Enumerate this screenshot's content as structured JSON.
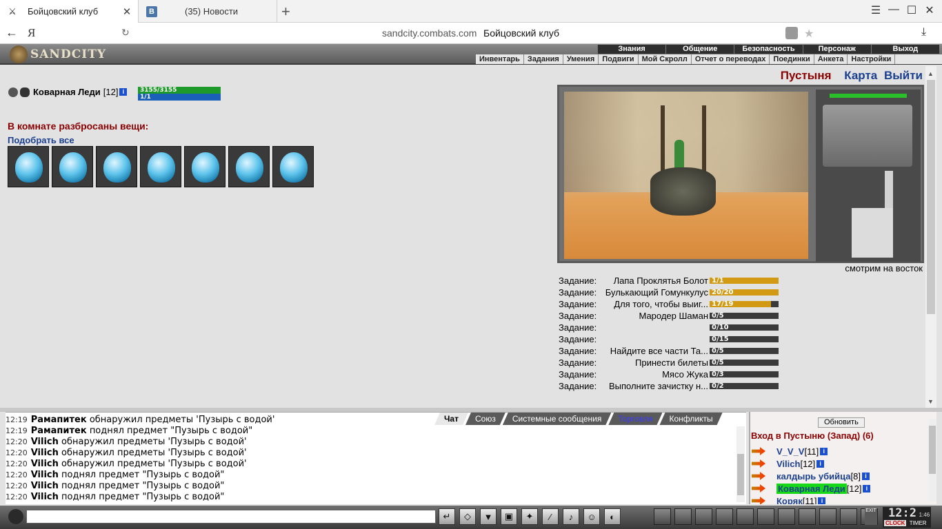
{
  "browser": {
    "tabs": [
      {
        "label": "Бойцовский клуб",
        "active": true
      },
      {
        "label": "(35) Новости",
        "active": false
      }
    ],
    "vk_badge": "В",
    "address": {
      "url": "sandcity.combats.com",
      "title": "Бойцовский клуб"
    },
    "yandex_label": "Я"
  },
  "game": {
    "logo": "SANDCITY",
    "top_menu": [
      "Знания",
      "Общение",
      "Безопасность",
      "Персонаж",
      "Выход"
    ],
    "sub_menu": [
      "Инвентарь",
      "Задания",
      "Умения",
      "Подвиги",
      "Мой Скролл",
      "Отчет о переводах",
      "Поединки",
      "Анкета",
      "Настройки"
    ],
    "player": {
      "name": "Коварная Леди",
      "level": "[12]",
      "hp": "3155/3155",
      "mp": "1/1",
      "info": "i"
    },
    "items": {
      "title": "В комнате разбросаны вещи:",
      "pick_all": "Подобрать все",
      "count": 7
    },
    "location": {
      "name": "Пустыня",
      "map": "Карта",
      "exit": "Выйти"
    },
    "facing": "смотрим на восток",
    "tasks": [
      {
        "label": "Задание:",
        "name": "Лапа Проклятья Болот",
        "progress": "1/1",
        "fraction": 1.0
      },
      {
        "label": "Задание:",
        "name": "Булькающий Гомункулус",
        "progress": "20/20",
        "fraction": 1.0
      },
      {
        "label": "Задание:",
        "name": "Для того, чтобы выиг...",
        "progress": "17/19",
        "fraction": 0.89
      },
      {
        "label": "Задание:",
        "name": "Мародер Шаман",
        "progress": "0/5",
        "fraction": 0
      },
      {
        "label": "Задание:",
        "name": "",
        "progress": "0/10",
        "fraction": 0
      },
      {
        "label": "Задание:",
        "name": "",
        "progress": "0/15",
        "fraction": 0
      },
      {
        "label": "Задание:",
        "name": "Найдите все части Та...",
        "progress": "0/5",
        "fraction": 0
      },
      {
        "label": "Задание:",
        "name": "Принести билеты",
        "progress": "0/5",
        "fraction": 0
      },
      {
        "label": "Задание:",
        "name": "Мясо Жука",
        "progress": "0/3",
        "fraction": 0
      },
      {
        "label": "Задание:",
        "name": "Выполните зачистку н...",
        "progress": "0/2",
        "fraction": 0
      }
    ]
  },
  "chat": {
    "tabs": [
      "Чат",
      "Союз",
      "Системные сообщения",
      "Торговля",
      "Конфликты"
    ],
    "lines": [
      {
        "time": "12:19",
        "user": "Рамапитек",
        "text": "обнаружил предметы 'Пузырь с водой'"
      },
      {
        "time": "12:19",
        "user": "Рамапитек",
        "text": "поднял предмет \"Пузырь с водой\""
      },
      {
        "time": "12:20",
        "user": "Vilich",
        "text": "обнаружил предметы 'Пузырь с водой'"
      },
      {
        "time": "12:20",
        "user": "Vilich",
        "text": "обнаружил предметы 'Пузырь с водой'"
      },
      {
        "time": "12:20",
        "user": "Vilich",
        "text": "обнаружил предметы 'Пузырь с водой'"
      },
      {
        "time": "12:20",
        "user": "Vilich",
        "text": "поднял предмет \"Пузырь с водой\""
      },
      {
        "time": "12:20",
        "user": "Vilich",
        "text": "поднял предмет \"Пузырь с водой\""
      },
      {
        "time": "12:20",
        "user": "Vilich",
        "text": "поднял предмет \"Пузырь с водой\""
      }
    ]
  },
  "room": {
    "refresh": "Обновить",
    "title": "Вход в Пустыню (Запад) (6)",
    "users": [
      {
        "name": "V_V_V",
        "level": "[11]",
        "highlight": false
      },
      {
        "name": "Vilich",
        "level": "[12]",
        "highlight": false
      },
      {
        "name": "калдырь убийца",
        "level": "[8]",
        "highlight": false
      },
      {
        "name": "Коварная Леди",
        "level": "[12]",
        "highlight": true
      },
      {
        "name": "Коряк",
        "level": "[11]",
        "highlight": false
      }
    ]
  },
  "toolbar": {
    "exit": "EXIT",
    "clock_time": "12:2",
    "clock_sec": "1:46",
    "clock_label": "CLOCK",
    "timer_label": "TIMER"
  }
}
